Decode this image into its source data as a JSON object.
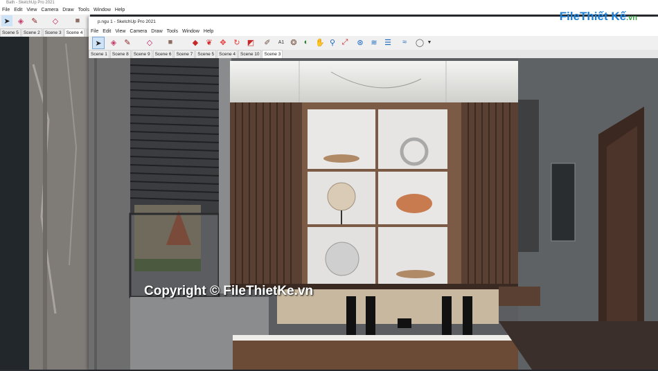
{
  "background_window": {
    "title": "Bath - SketchUp Pro 2021",
    "menu": [
      "File",
      "Edit",
      "View",
      "Camera",
      "Draw",
      "Tools",
      "Window",
      "Help"
    ],
    "scenes": [
      "Scene 5",
      "Scene 2",
      "Scene 3",
      "Scene 4"
    ],
    "active_scene": 3
  },
  "front_window": {
    "title": "p.ngu 1 - SketchUp Pro 2021",
    "menu": [
      "File",
      "Edit",
      "View",
      "Camera",
      "Draw",
      "Tools",
      "Window",
      "Help"
    ],
    "scenes": [
      "Scene 1",
      "Scene 8",
      "Scene 9",
      "Scene 6",
      "Scene 7",
      "Scene 5",
      "Scene 4",
      "Scene 10",
      "Scene 3"
    ],
    "active_scene": 8
  },
  "toolbar_icons": [
    "select-icon",
    "eraser-icon",
    "pencil-icon",
    "shape-icon",
    "paint-bucket-icon",
    "push-pull-icon",
    "follow-me-icon",
    "move-icon",
    "rotate-icon",
    "scale-icon",
    "tape-measure-icon",
    "text-icon",
    "paint-icon",
    "orbit-icon",
    "pan-icon",
    "zoom-icon",
    "zoom-extents-icon",
    "warehouse-icon",
    "extension-icon",
    "layers-icon",
    "sandbox-icon",
    "account-icon"
  ],
  "watermark": {
    "brand_a": "File",
    "brand_b": "Thiết Kế",
    "brand_c": ".vn",
    "copyright": "Copyright © FileThietKe.vn"
  },
  "colors": {
    "accent": "#1e73be",
    "brand_blue": "#1e7fd8",
    "brand_green": "#3da34a"
  }
}
